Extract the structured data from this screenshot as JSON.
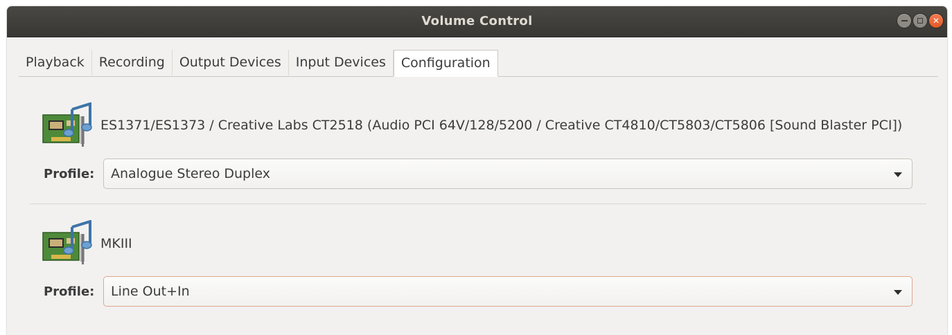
{
  "window": {
    "title": "Volume Control"
  },
  "tabs": [
    {
      "label": "Playback",
      "active": false
    },
    {
      "label": "Recording",
      "active": false
    },
    {
      "label": "Output Devices",
      "active": false
    },
    {
      "label": "Input Devices",
      "active": false
    },
    {
      "label": "Configuration",
      "active": true
    }
  ],
  "cards": [
    {
      "icon": "sound-card-icon",
      "name": "ES1371/ES1373 / Creative Labs CT2518 (Audio PCI 64V/128/5200 / Creative CT4810/CT5803/CT5806 [Sound Blaster PCI])",
      "profile_label": "Profile:",
      "profile_value": "Analogue Stereo Duplex"
    },
    {
      "icon": "sound-card-icon",
      "name": "MKIII",
      "profile_label": "Profile:",
      "profile_value": "Line Out+In"
    }
  ],
  "colors": {
    "titlebar": "#3e3c38",
    "close_button": "#e9602f",
    "window_bg": "#f2f1f0",
    "focus_border": "#e0a78e"
  }
}
